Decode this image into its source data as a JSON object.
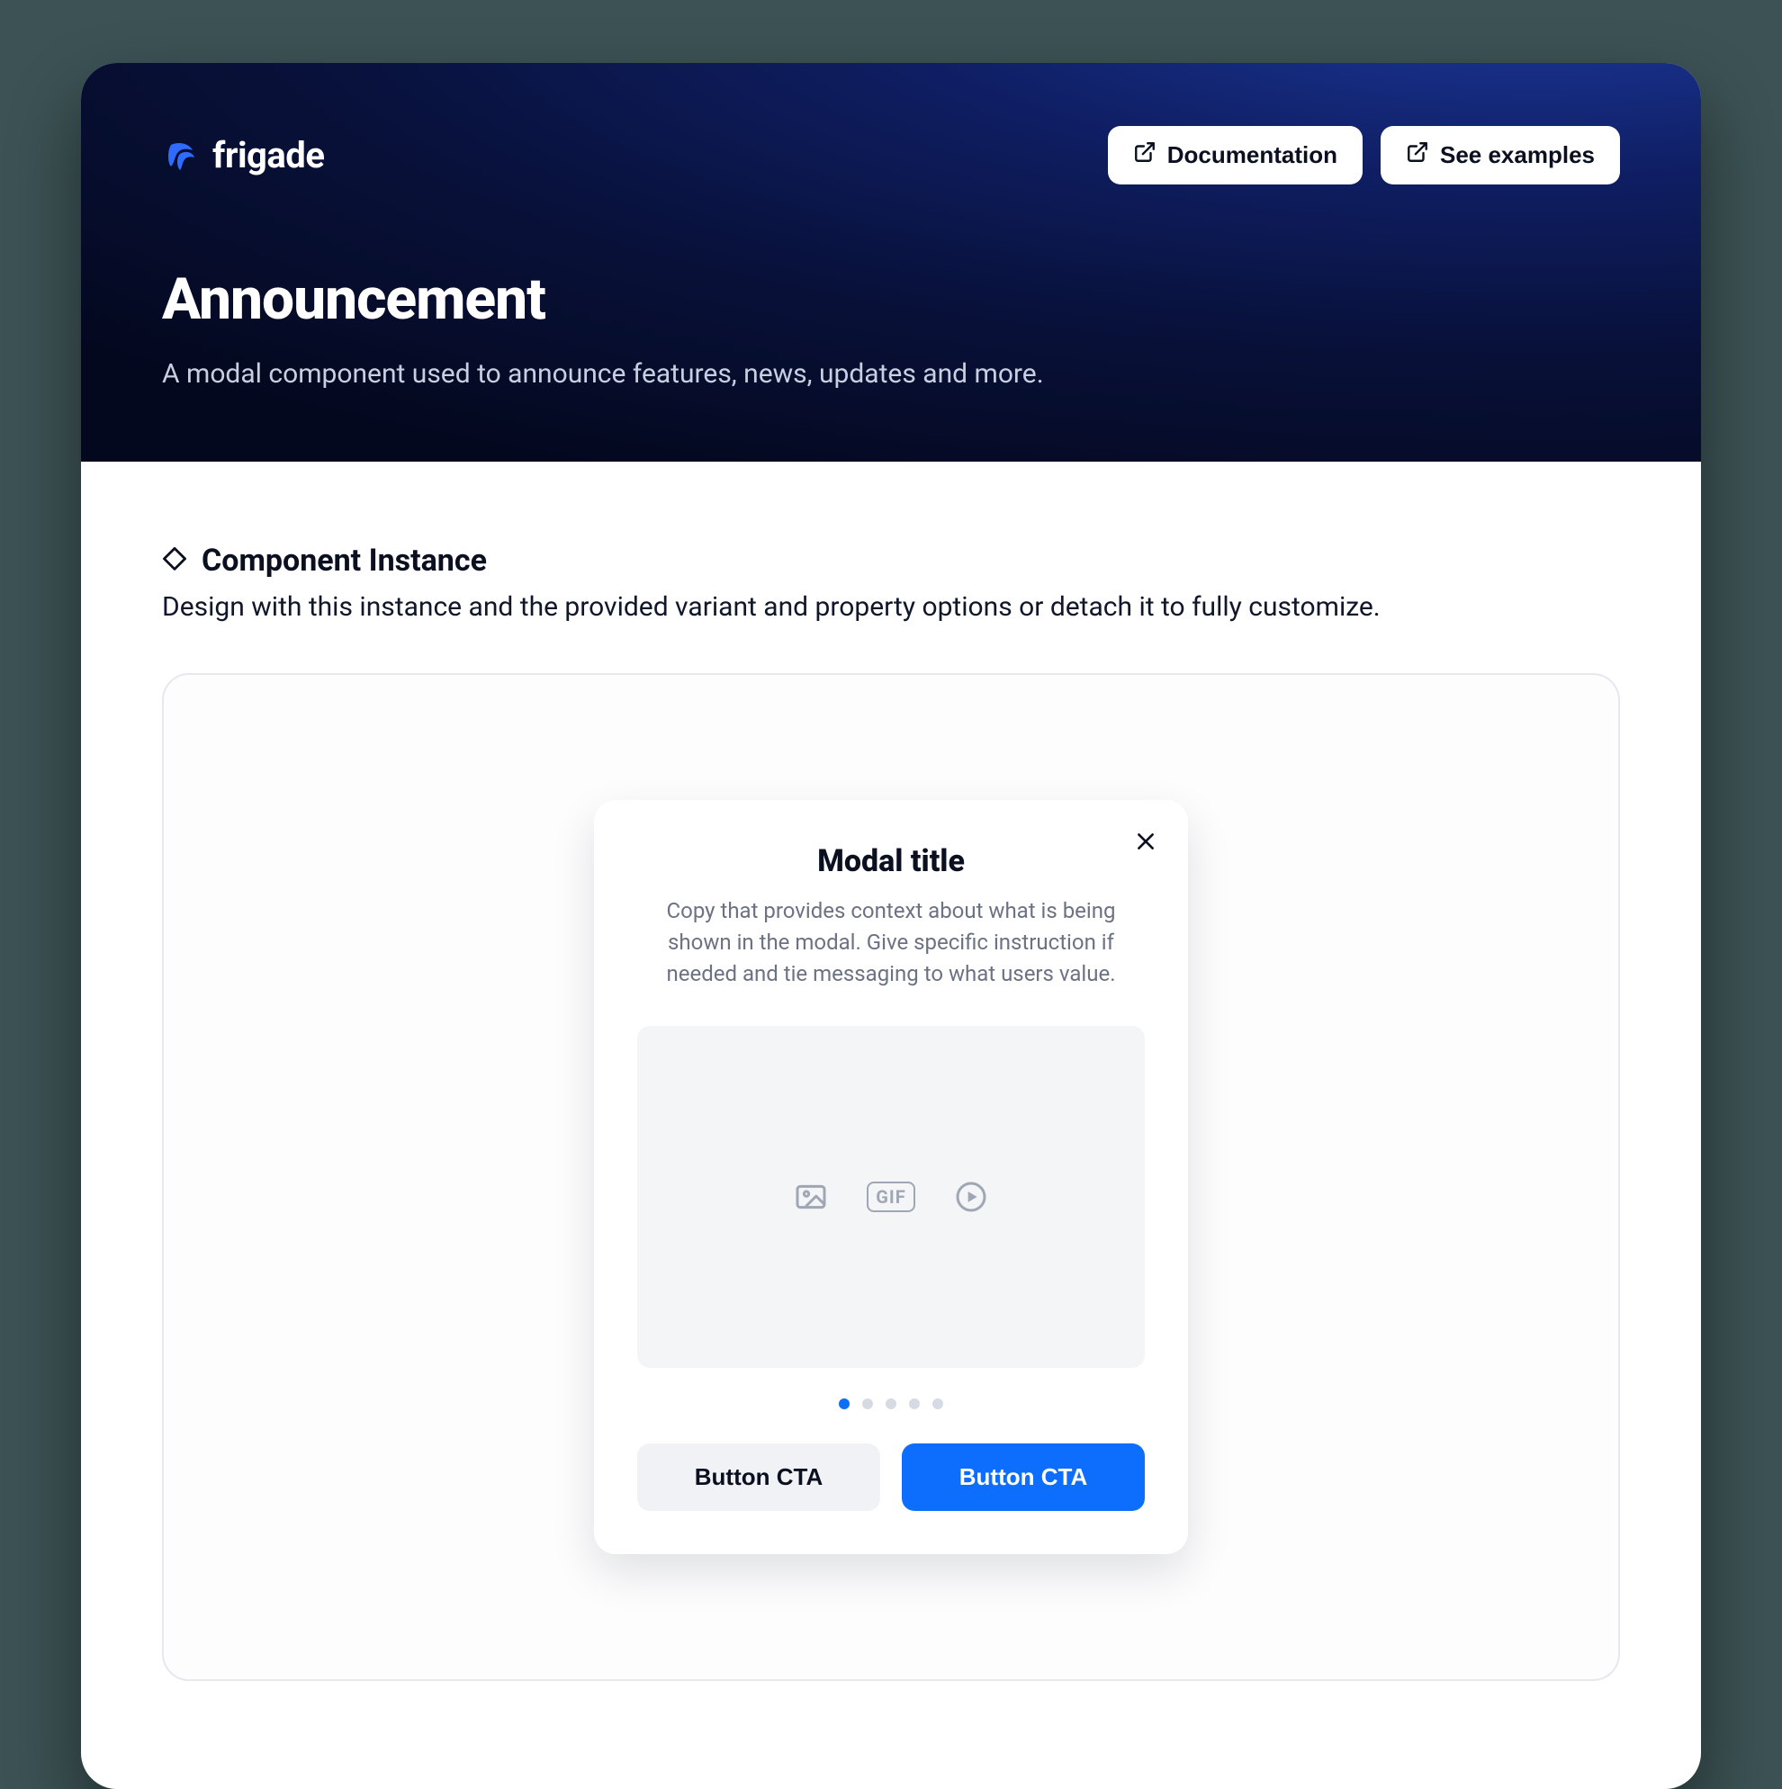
{
  "brand": {
    "name": "frigade"
  },
  "header": {
    "doc_btn": "Documentation",
    "examples_btn": "See examples",
    "title": "Announcement",
    "subtitle": "A modal component used to announce features, news, updates and more."
  },
  "section": {
    "heading": "Component Instance",
    "subheading": "Design with this instance and the provided variant and property options or detach it to fully customize."
  },
  "modal": {
    "title": "Modal title",
    "copy": "Copy that provides context about what is being shown in the modal. Give specific instruction if needed and tie messaging to what users value.",
    "media_icons": {
      "image": "image-icon",
      "gif": "GIF",
      "video": "play-icon"
    },
    "dots_total": 5,
    "dots_active_index": 0,
    "secondary_cta": "Button CTA",
    "primary_cta": "Button CTA"
  },
  "colors": {
    "accent": "#0d6efd",
    "hero_bg_dark": "#04081e",
    "hero_bg_light": "#1d3a9e",
    "text_muted": "#6a7283"
  }
}
